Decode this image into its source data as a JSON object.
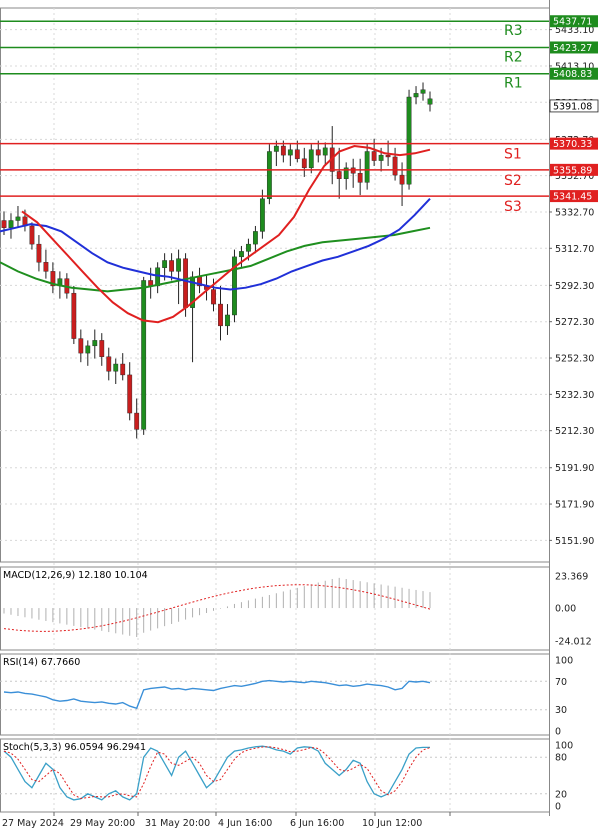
{
  "chart_data": {
    "type": "candlestick",
    "main": {
      "ylim": [
        5140,
        5445
      ],
      "y_ticks": [
        "5433.10",
        "5413.10",
        "5393.10",
        "5372.70",
        "5352.70",
        "5332.70",
        "5312.70",
        "5292.30",
        "5272.30",
        "5252.30",
        "5232.30",
        "5212.30",
        "5191.90",
        "5171.90",
        "5151.90"
      ],
      "levels": [
        {
          "label": "R3",
          "price": 5437.71,
          "price_text": "5437.71",
          "color": "#1e8c1e"
        },
        {
          "label": "R2",
          "price": 5423.27,
          "price_text": "5423.27",
          "color": "#1e8c1e"
        },
        {
          "label": "R1",
          "price": 5408.83,
          "price_text": "5408.83",
          "color": "#1e8c1e"
        },
        {
          "label": "S1",
          "price": 5370.33,
          "price_text": "5370.33",
          "color": "#e02020"
        },
        {
          "label": "S2",
          "price": 5355.89,
          "price_text": "5355.89",
          "color": "#e02020"
        },
        {
          "label": "S3",
          "price": 5341.45,
          "price_text": "5341.45",
          "color": "#e02020"
        }
      ],
      "current_price": {
        "price": 5391.08,
        "text": "5391.08"
      },
      "candles": [
        [
          5328,
          5333,
          5320,
          5324
        ],
        [
          5324,
          5332,
          5318,
          5328
        ],
        [
          5328,
          5336,
          5324,
          5330
        ],
        [
          5330,
          5334,
          5322,
          5325
        ],
        [
          5325,
          5327,
          5312,
          5315
        ],
        [
          5315,
          5320,
          5300,
          5305
        ],
        [
          5305,
          5312,
          5296,
          5300
        ],
        [
          5300,
          5305,
          5288,
          5292
        ],
        [
          5292,
          5300,
          5285,
          5296
        ],
        [
          5296,
          5299,
          5285,
          5288
        ],
        [
          5288,
          5292,
          5260,
          5263
        ],
        [
          5263,
          5268,
          5250,
          5255
        ],
        [
          5255,
          5262,
          5248,
          5259
        ],
        [
          5259,
          5268,
          5252,
          5262
        ],
        [
          5262,
          5266,
          5248,
          5253
        ],
        [
          5253,
          5258,
          5240,
          5245
        ],
        [
          5245,
          5252,
          5238,
          5249
        ],
        [
          5249,
          5255,
          5240,
          5243
        ],
        [
          5243,
          5250,
          5218,
          5222
        ],
        [
          5222,
          5230,
          5208,
          5213
        ],
        [
          5213,
          5297,
          5210,
          5295
        ],
        [
          5295,
          5302,
          5285,
          5292
        ],
        [
          5292,
          5305,
          5288,
          5302
        ],
        [
          5302,
          5310,
          5295,
          5306
        ],
        [
          5306,
          5310,
          5295,
          5300
        ],
        [
          5300,
          5312,
          5282,
          5307
        ],
        [
          5307,
          5310,
          5275,
          5280
        ],
        [
          5280,
          5300,
          5250,
          5297
        ],
        [
          5297,
          5302,
          5288,
          5292
        ],
        [
          5292,
          5298,
          5284,
          5290
        ],
        [
          5290,
          5296,
          5278,
          5282
        ],
        [
          5282,
          5292,
          5262,
          5270
        ],
        [
          5270,
          5282,
          5265,
          5276
        ],
        [
          5276,
          5312,
          5272,
          5308
        ],
        [
          5308,
          5314,
          5302,
          5311
        ],
        [
          5311,
          5318,
          5306,
          5315
        ],
        [
          5315,
          5325,
          5310,
          5322
        ],
        [
          5322,
          5345,
          5318,
          5340
        ],
        [
          5340,
          5370,
          5337,
          5366
        ],
        [
          5366,
          5372,
          5358,
          5369
        ],
        [
          5369,
          5372,
          5360,
          5364
        ],
        [
          5364,
          5370,
          5358,
          5367
        ],
        [
          5367,
          5372,
          5360,
          5362
        ],
        [
          5362,
          5368,
          5352,
          5357
        ],
        [
          5357,
          5370,
          5354,
          5367
        ],
        [
          5367,
          5372,
          5360,
          5364
        ],
        [
          5364,
          5371,
          5358,
          5368
        ],
        [
          5368,
          5380,
          5348,
          5355
        ],
        [
          5355,
          5368,
          5340,
          5351
        ],
        [
          5351,
          5360,
          5345,
          5357
        ],
        [
          5357,
          5362,
          5346,
          5354
        ],
        [
          5354,
          5362,
          5342,
          5349
        ],
        [
          5349,
          5370,
          5345,
          5366
        ],
        [
          5366,
          5373,
          5358,
          5361
        ],
        [
          5361,
          5368,
          5355,
          5364
        ],
        [
          5364,
          5372,
          5358,
          5363
        ],
        [
          5363,
          5368,
          5350,
          5353
        ],
        [
          5353,
          5360,
          5336,
          5348
        ],
        [
          5348,
          5400,
          5345,
          5396
        ],
        [
          5396,
          5402,
          5392,
          5398
        ],
        [
          5398,
          5404,
          5394,
          5400
        ],
        [
          5392,
          5399,
          5388,
          5395
        ]
      ],
      "ma_fast": [
        5333,
        5327,
        5318,
        5309,
        5300,
        5291,
        5283,
        5277,
        5273,
        5272,
        5275,
        5281,
        5288,
        5295,
        5302,
        5308,
        5314,
        5320,
        5330,
        5345,
        5358,
        5366,
        5369,
        5368,
        5365,
        5364,
        5365,
        5367
      ],
      "ma_mid": [
        5322,
        5324,
        5326,
        5325,
        5322,
        5316,
        5310,
        5305,
        5302,
        5300,
        5298,
        5297,
        5295,
        5293,
        5291,
        5290,
        5291,
        5293,
        5296,
        5300,
        5303,
        5306,
        5308,
        5311,
        5314,
        5318,
        5323,
        5331,
        5340
      ],
      "ma_slow": [
        5305,
        5300,
        5296,
        5293,
        5291,
        5290,
        5289,
        5290,
        5291,
        5293,
        5295,
        5297,
        5299,
        5301,
        5303,
        5307,
        5311,
        5314,
        5316,
        5317,
        5318,
        5319,
        5320,
        5322,
        5324
      ]
    },
    "macd": {
      "label": "MACD(12,26,9) 12.180 10.104",
      "y_ticks": [
        "23.369",
        "0.00",
        "-24.012"
      ],
      "ylim": [
        -24.012,
        23.369
      ]
    },
    "rsi": {
      "label": "RSI(14) 67.7660",
      "y_ticks": [
        "100",
        "70",
        "30",
        "0"
      ],
      "ylim": [
        0,
        100
      ]
    },
    "stoch": {
      "label": "Stoch(5,3,3) 96.0594 96.2941",
      "y_ticks": [
        "100",
        "80",
        "20",
        "0"
      ],
      "ylim": [
        0,
        100
      ]
    },
    "x_ticks": [
      "27 May 2024",
      "29 May 20:00",
      "31 May 20:00",
      "4 Jun 16:00",
      "6 Jun 16:00",
      "10 Jun 12:00"
    ]
  }
}
